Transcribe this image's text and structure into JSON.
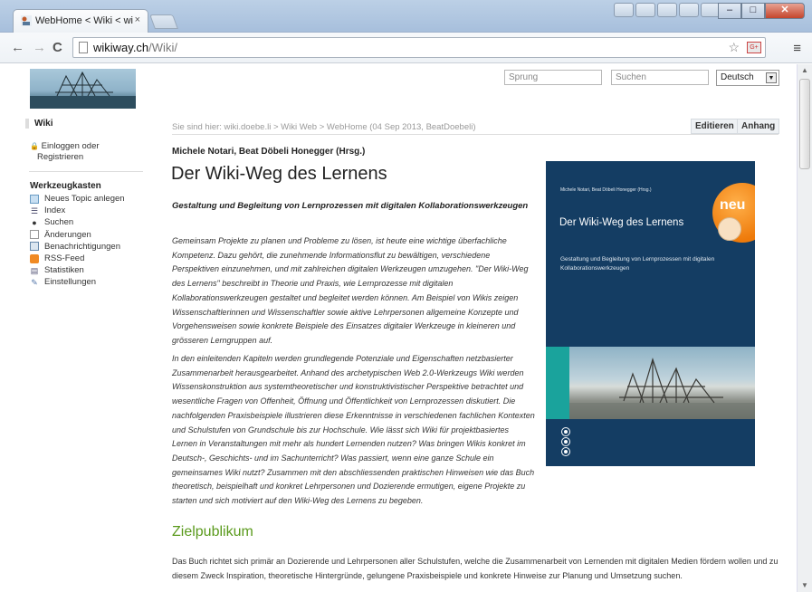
{
  "browser": {
    "tab_title": "WebHome < Wiki < wiki.c",
    "tab_close": "×",
    "url_host": "wikiway.ch",
    "url_path": "/Wiki/",
    "ext_label": "G+"
  },
  "header": {
    "jump_placeholder": "Sprung",
    "search_placeholder": "Suchen",
    "language": "Deutsch"
  },
  "sidebar": {
    "wiki_label": "Wiki",
    "login_label_1": "Einloggen oder",
    "login_label_2": "Registrieren",
    "tools_title": "Werkzeugkasten",
    "items": [
      {
        "label": "Neues Topic anlegen",
        "icon": "new-topic-icon"
      },
      {
        "label": "Index",
        "icon": "index-icon"
      },
      {
        "label": "Suchen",
        "icon": "search-icon"
      },
      {
        "label": "Änderungen",
        "icon": "changes-icon"
      },
      {
        "label": "Benachrichtigungen",
        "icon": "notifications-icon"
      },
      {
        "label": "RSS-Feed",
        "icon": "rss-icon"
      },
      {
        "label": "Statistiken",
        "icon": "statistics-icon"
      },
      {
        "label": "Einstellungen",
        "icon": "settings-icon"
      }
    ]
  },
  "breadcrumb": "Sie sind hier: wiki.doebe.li > Wiki Web > WebHome (04 Sep 2013, BeatDoebeli)",
  "actions": {
    "edit": "Editieren",
    "attach": "Anhang"
  },
  "main": {
    "authors": "Michele Notari, Beat Döbeli Honegger (Hrsg.)",
    "title": "Der Wiki-Weg des Lernens",
    "subtitle": "Gestaltung und Begleitung von Lernprozessen mit digitalen Kollaborationswerkzeugen",
    "paragraph_1": "Gemeinsam Projekte zu planen und Probleme zu lösen, ist heute eine wichtige überfachliche Kompetenz. Dazu gehört, die zunehmende Informationsflut zu bewältigen, verschiedene Perspektiven einzunehmen, und mit zahlreichen digitalen Werkzeugen umzugehen. \"Der Wiki-Weg des Lernens\" beschreibt in Theorie und Praxis, wie Lernprozesse mit digitalen Kollaborationswerkzeugen gestaltet und begleitet werden können. Am Beispiel von Wikis zeigen Wissenschaftlerinnen und Wissenschaftler sowie aktive Lehrpersonen allgemeine Konzepte und Vorgehensweisen sowie konkrete Beispiele des Einsatzes digitaler Werkzeuge in kleineren und grösseren Lerngruppen auf.",
    "paragraph_2": "In den einleitenden Kapiteln werden grundlegende Potenziale und Eigenschaften netzbasierter Zusammenarbeit herausgearbeitet. Anhand des archetypischen Web 2.0-Werkzeugs Wiki werden Wissenskonstruktion aus systemtheoretischer und konstruktivistischer Perspektive betrachtet und wesentliche Fragen von Offenheit, Öffnung und Öffentlichkeit von Lernprozessen diskutiert. Die nachfolgenden Praxisbeispiele illustrieren diese Erkenntnisse in verschiedenen fachlichen Kontexten und Schulstufen von Grundschule bis zur Hochschule. Wie lässt sich Wiki für projektbasiertes Lernen in Veranstaltungen mit mehr als hundert Lernenden nutzen? Was bringen Wikis konkret im Deutsch-, Geschichts- und im Sachunterricht? Was passiert, wenn eine ganze Schule ein gemeinsames Wiki nutzt? Zusammen mit den abschliessenden praktischen Hinweisen wie das Buch theoretisch, beispielhaft und konkret Lehrpersonen und Dozierende ermutigen, eigene Projekte zu starten und sich motiviert auf den Wiki-Weg des Lernens zu begeben.",
    "section_heading": "Zielpublikum",
    "paragraph_3": "Das Buch richtet sich primär an Dozierende und Lehrpersonen aller Schulstufen, welche die Zusammenarbeit von Lernenden mit digitalen Medien fördern wollen und zu diesem Zweck Inspiration, theoretische Hintergründe, gelungene Praxisbeispiele und konkrete Hinweise zur Planung und Umsetzung suchen."
  },
  "cover": {
    "authors": "Michele Notari, Beat Döbeli Honegger (Hrsg.)",
    "title": "Der Wiki-Weg des Lernens",
    "subtitle": "Gestaltung und Begleitung von Lernprozessen mit digitalen Kollaborationswerkzeugen",
    "badge": "neu",
    "colors": {
      "background": "#143d63",
      "badge": "#ee7a0a",
      "accent": "#1aa39c"
    }
  }
}
